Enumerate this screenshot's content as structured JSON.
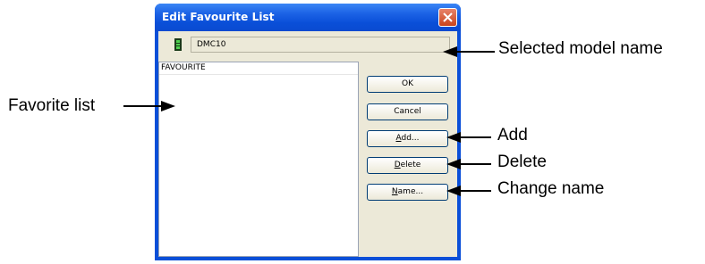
{
  "dialog": {
    "title": "Edit Favourite List",
    "model_name": "DMC10",
    "list_header": "FAVOURITE",
    "buttons": {
      "ok": "OK",
      "cancel": "Cancel",
      "add": "Add...",
      "delete": "Delete",
      "name": "Name..."
    }
  },
  "callouts": {
    "selected_model": "Selected model name",
    "favorite_list": "Favorite list",
    "add": "Add",
    "delete": "Delete",
    "change_name": "Change name"
  }
}
